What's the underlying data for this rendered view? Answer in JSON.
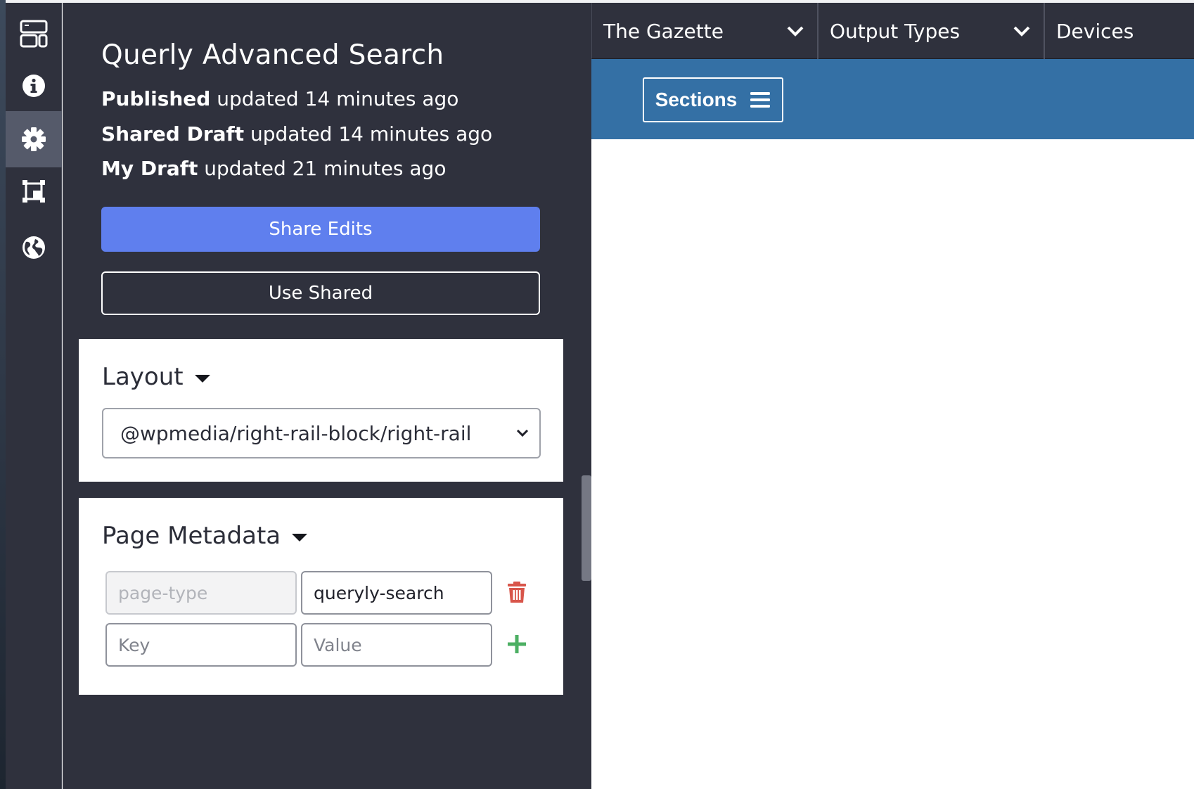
{
  "rail": {
    "items": [
      {
        "icon": "layout-blocks-icon",
        "active": false
      },
      {
        "icon": "info-icon",
        "active": false
      },
      {
        "icon": "gear-icon",
        "active": true
      },
      {
        "icon": "crop-frame-icon",
        "active": false
      },
      {
        "icon": "globe-icon",
        "active": false
      }
    ]
  },
  "panel": {
    "title": "Querly Advanced Search",
    "status": [
      {
        "label": "Published",
        "text": "updated 14 minutes ago"
      },
      {
        "label": "Shared Draft",
        "text": "updated 14 minutes ago"
      },
      {
        "label": "My Draft",
        "text": "updated 21 minutes ago"
      }
    ],
    "share_button": "Share Edits",
    "use_shared_button": "Use Shared",
    "layout": {
      "title": "Layout",
      "selected": "@wpmedia/right-rail-block/right-rail"
    },
    "metadata": {
      "title": "Page Metadata",
      "rows": [
        {
          "key_placeholder": "page-type",
          "value": "queryly-search",
          "action_icon": "trash-icon"
        },
        {
          "key_placeholder": "Key",
          "value_placeholder": "Value",
          "action_icon": "plus-icon"
        }
      ]
    }
  },
  "topbar": {
    "dropdowns": [
      "The Gazette",
      "Output Types",
      "Devices"
    ]
  },
  "preview": {
    "sections_button": "Sections",
    "band_color": "#3470a5"
  },
  "colors": {
    "panel_bg": "#2f313d",
    "accent": "#5f7fee",
    "danger": "#d8554a",
    "success": "#4caf63"
  }
}
